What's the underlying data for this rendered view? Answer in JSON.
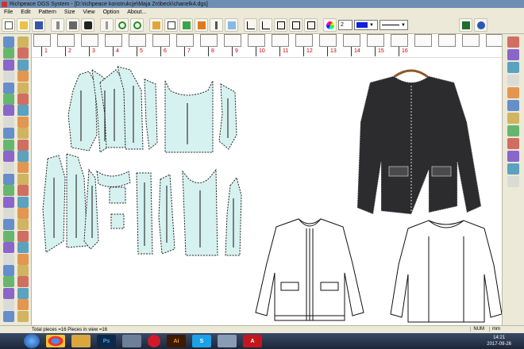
{
  "window": {
    "title": "Richpeace DGS System - [D:\\richpeace konstrukcje\\Maja Zróbeck\\chanelk4.dgs]"
  },
  "menu": [
    "File",
    "Edit",
    "Pattern",
    "Size",
    "View",
    "Option",
    "About..."
  ],
  "toolbar": {
    "line_width": "2",
    "color_value": "#1020e0",
    "icons": [
      "new-icon",
      "open-icon",
      "save-icon",
      "print-icon",
      "cut-icon",
      "copy-icon",
      "undo-icon",
      "redo-icon",
      "zoom-in-icon",
      "zoom-out-icon",
      "fill-icon",
      "brush-icon",
      "measure-icon",
      "grade-icon",
      "color-wheel-icon",
      "monitor-icon",
      "help-icon"
    ]
  },
  "ruler": {
    "sizes": [
      "1",
      "2",
      "3",
      "4",
      "5",
      "6",
      "7",
      "8",
      "9",
      "10",
      "11",
      "12",
      "13",
      "14",
      "15",
      "16"
    ]
  },
  "status": {
    "summary": "Total pieces =16   Pieces in view =16",
    "num": "NUM",
    "unit": "mm"
  },
  "taskbar": {
    "time": "14:21",
    "date": "2017-09-26",
    "apps": [
      "chrome",
      "explorer",
      "photoshop",
      "media-player",
      "opera",
      "illustrator",
      "skype",
      "dgs",
      "acrobat"
    ]
  },
  "canvas": {
    "pieces_count": 16
  }
}
